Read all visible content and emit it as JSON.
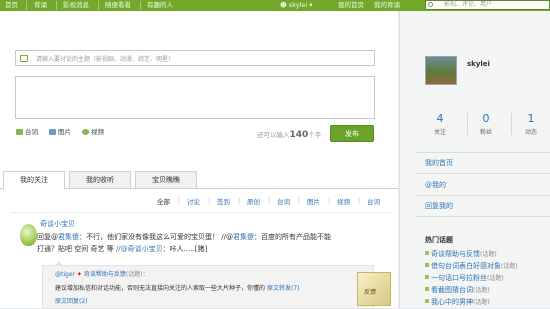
{
  "topbar": {
    "nav": [
      "首页",
      "背诵",
      "影视消息",
      "随便看看",
      "有趣的人"
    ],
    "user": "skylei",
    "links": [
      "我的首页",
      "我的背诵"
    ],
    "search_placeholder": "影视、评论、用户"
  },
  "composer": {
    "topic_placeholder": "请输入要讨论的主题（影视剧、动漫、综艺、明星）",
    "tools": [
      "台词",
      "图片",
      "视频"
    ],
    "counter_prefix": "还可以输入",
    "counter_value": "140",
    "counter_suffix": "个字",
    "publish": "发布"
  },
  "tabs": [
    "我的关注",
    "我的收听",
    "宝贝瞧瞧"
  ],
  "filters": [
    "全部",
    "讨论",
    "签到",
    "原创",
    "台词",
    "图片",
    "视频",
    "台词"
  ],
  "post": {
    "author": "奇谈小宝贝",
    "text1_a": "回复@",
    "text1_b": "君集傻",
    "text1_c": "：不行，他们家没有像我这么可爱的宝贝蛋！ //@",
    "text1_d": "君集傻",
    "text1_e": "：百度的所有产品能不能",
    "text2_a": "打通？貼吧",
    "text2_b": "空间",
    "text2_c": "奇艺",
    "text2_d": "等",
    "text2_e": "//@奇谈小宝贝",
    "text2_f": "：咔人.....[猪]",
    "quote": {
      "user": "@tiger",
      "topic": "奇谈帮助与反馈",
      "suffix": "(话题)：",
      "line2": "建议增加私信和对话功能，否则无法直接向关注的人索取一些大片种子，你懂的",
      "link": "原文转发(7)",
      "line3": "原文回复(2)",
      "sign": "反馈"
    }
  },
  "sidebar": {
    "username": "skylei",
    "stats": [
      {
        "num": "4",
        "label": "关注"
      },
      {
        "num": "0",
        "label": "粉丝"
      },
      {
        "num": "1",
        "label": "动态"
      }
    ],
    "links": [
      "我的首页",
      "@我的",
      "回复我的"
    ],
    "hot_title": "热门话题",
    "hot": [
      {
        "name": "奇谈帮助与反馈",
        "count": "(话题)"
      },
      {
        "name": "借句台词表白好感对象",
        "count": "(话题)"
      },
      {
        "name": "一句话口号拉粉丝",
        "count": "(话题)"
      },
      {
        "name": "看截图猜台词",
        "count": "(话题)"
      },
      {
        "name": "我心中的男神",
        "count": "(话题)"
      }
    ]
  }
}
